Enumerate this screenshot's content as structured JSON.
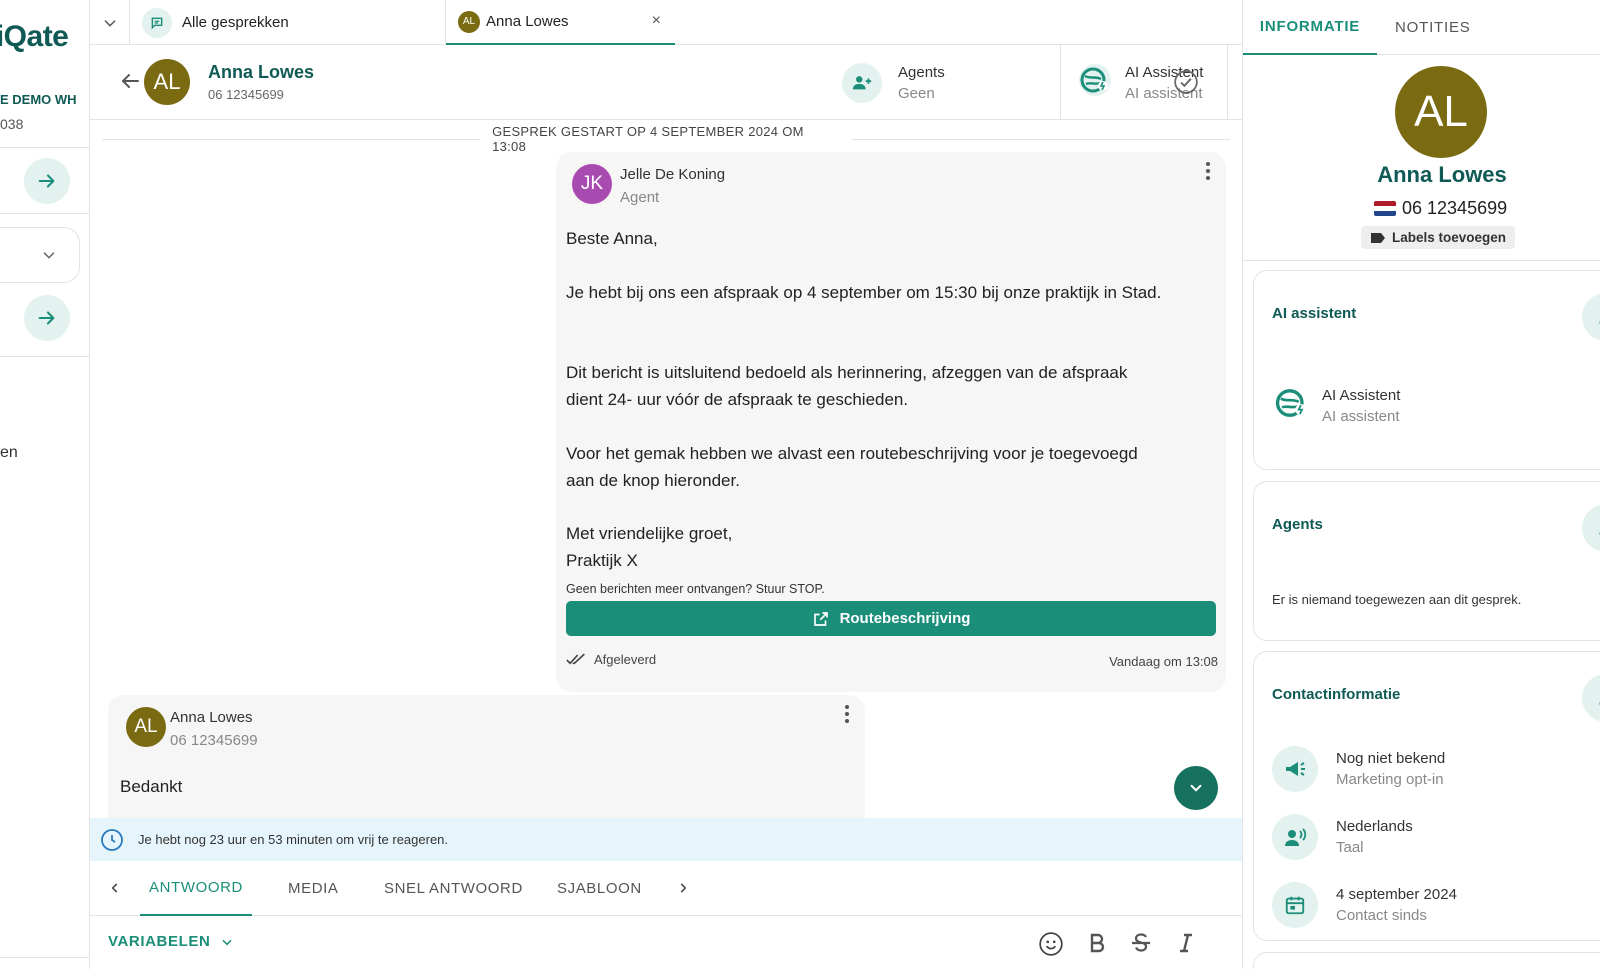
{
  "sidebar": {
    "logo": "iiQate",
    "org_name": "E DEMO WH",
    "org_number": "038",
    "partial_label": "en"
  },
  "tabs": [
    {
      "label": "Alle gesprekken",
      "icon": "chat-icon"
    },
    {
      "label": "Anna Lowes",
      "avatar": "AL",
      "close": "×"
    }
  ],
  "header": {
    "avatar": "AL",
    "name": "Anna Lowes",
    "phone": "06 12345699",
    "agents_label": "Agents",
    "agents_value": "Geen",
    "ai_label": "AI Assistent",
    "ai_value": "AI assistent"
  },
  "chat": {
    "started": "GESPREK GESTART OP 4 SEPTEMBER 2024 OM 13:08",
    "outgoing": {
      "avatar": "JK",
      "sender": "Jelle De Koning",
      "role": "Agent",
      "lines": [
        "Beste Anna,",
        "Je hebt bij ons een afspraak op 4 september om 15:30 bij onze praktijk in Stad.",
        "Dit bericht is uitsluitend bedoeld als herinnering, afzeggen van de afspraak",
        "dient 24- uur vóór de afspraak te geschieden.",
        "Voor het gemak hebben we alvast een routebeschrijving voor je toegevoegd",
        "aan de knop hieronder.",
        "Met vriendelijke groet,",
        "Praktijk X"
      ],
      "stop_note": "Geen berichten meer ontvangen? Stuur STOP.",
      "button": "Routebeschrijving",
      "status": "Afgeleverd",
      "time": "Vandaag om 13:08"
    },
    "incoming": {
      "avatar": "AL",
      "sender": "Anna Lowes",
      "phone": "06 12345699",
      "text": "Bedankt"
    }
  },
  "info_bar": "Je hebt nog 23 uur en 53 minuten om vrij te reageren.",
  "reply_tabs": [
    "ANTWOORD",
    "MEDIA",
    "SNEL ANTWOORD",
    "SJABLOON"
  ],
  "composer": {
    "variables_label": "VARIABELEN"
  },
  "right_panel": {
    "tabs": [
      "INFORMATIE",
      "NOTITIES"
    ],
    "avatar": "AL",
    "name": "Anna Lowes",
    "phone": "06 12345699",
    "labels_button": "Labels toevoegen",
    "ai_card": {
      "title": "AI assistent",
      "name": "AI Assistent",
      "sub": "AI assistent"
    },
    "agents_card": {
      "title": "Agents",
      "empty": "Er is niemand toegewezen aan dit gesprek."
    },
    "contact_card": {
      "title": "Contactinformatie",
      "items": [
        {
          "value": "Nog niet bekend",
          "label": "Marketing opt-in",
          "icon": "megaphone-icon"
        },
        {
          "value": "Nederlands",
          "label": "Taal",
          "icon": "speaking-person-icon"
        },
        {
          "value": "4 september 2024",
          "label": "Contact sinds",
          "icon": "calendar-icon"
        }
      ]
    }
  },
  "colors": {
    "accent": "#1b8e7a",
    "dark_teal": "#0f5a55",
    "avatar_olive": "#7a6a12",
    "agent_purple": "#a84bb1",
    "info_bg": "#e6f5fb"
  }
}
